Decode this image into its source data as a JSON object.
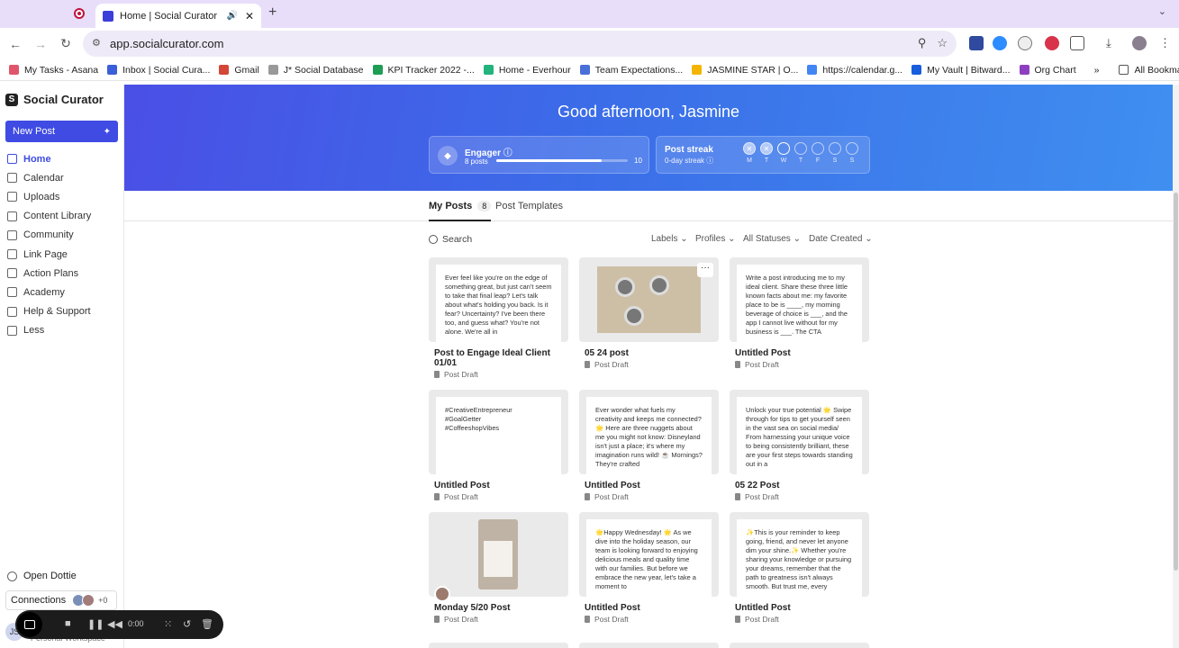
{
  "browser": {
    "tab_title": "Home | Social Curator",
    "tab_close": "✕",
    "new_tab": "+",
    "tab_menu": "⌄",
    "url": "app.socialcurator.com",
    "bookmarks": [
      {
        "label": "My Tasks - Asana",
        "color": "#e0556b"
      },
      {
        "label": "Inbox | Social Cura...",
        "color": "#3b5fd8"
      },
      {
        "label": "Gmail",
        "color": "#d44638"
      },
      {
        "label": "J* Social Database",
        "color": "#999999"
      },
      {
        "label": "KPI Tracker 2022 -...",
        "color": "#1f9d55"
      },
      {
        "label": "Home - Everhour",
        "color": "#23b37d"
      },
      {
        "label": "Team Expectations...",
        "color": "#4a6fd8"
      },
      {
        "label": "JASMINE STAR | O...",
        "color": "#f4b400"
      },
      {
        "label": "https://calendar.g...",
        "color": "#4285f4"
      },
      {
        "label": "My Vault | Bitward...",
        "color": "#175ddc"
      },
      {
        "label": "Org Chart",
        "color": "#8e3fbf"
      }
    ],
    "bookmarks_more": "»",
    "all_bookmarks": "All Bookmarks"
  },
  "sidebar": {
    "brand": "Social Curator",
    "new_post": "New Post",
    "items": [
      {
        "label": "Home",
        "active": true
      },
      {
        "label": "Calendar"
      },
      {
        "label": "Uploads"
      },
      {
        "label": "Content Library"
      },
      {
        "label": "Community"
      },
      {
        "label": "Link Page"
      },
      {
        "label": "Action Plans"
      },
      {
        "label": "Academy"
      },
      {
        "label": "Help & Support"
      },
      {
        "label": "Less"
      }
    ],
    "open_dottie": "Open Dottie",
    "connections": "Connections",
    "connections_more": "+0",
    "workspace_initials": "JS",
    "workspace_label": "Personal Workspace"
  },
  "hero": {
    "greeting": "Good afternoon, Jasmine",
    "engager": {
      "title": "Engager",
      "sub": "8 posts",
      "max": "10",
      "progress": 0.8
    },
    "streak": {
      "title": "Post streak",
      "sub": "0-day streak",
      "days": [
        {
          "label": "M",
          "mark": "✕",
          "state": "done"
        },
        {
          "label": "T",
          "mark": "✕",
          "state": "done"
        },
        {
          "label": "W",
          "mark": "",
          "state": "today"
        },
        {
          "label": "T",
          "mark": "",
          "state": ""
        },
        {
          "label": "F",
          "mark": "",
          "state": ""
        },
        {
          "label": "S",
          "mark": "",
          "state": ""
        },
        {
          "label": "S",
          "mark": "",
          "state": ""
        }
      ]
    }
  },
  "tabs": {
    "my_posts": "My Posts",
    "my_posts_count": "8",
    "templates": "Post Templates"
  },
  "filters": {
    "search": "Search",
    "labels": "Labels ⌄",
    "profiles": "Profiles ⌄",
    "statuses": "All Statuses ⌄",
    "date": "Date Created ⌄"
  },
  "posts": [
    {
      "title": "Post to Engage Ideal Client 01/01",
      "status": "Post Draft",
      "text": "Ever feel like you're on the edge of something great, but just can't seem to take that final leap? Let's talk about what's holding you back. Is it fear? Uncertainty? I've been there too, and guess what? You're not alone. We're all in"
    },
    {
      "title": "05 24 post",
      "status": "Post Draft",
      "text": "",
      "more": "···"
    },
    {
      "title": "Untitled Post",
      "status": "Post Draft",
      "text": "Write a post introducing me to my ideal client. Share these three little known facts about me: my favorite place to be is ____, my morning beverage of choice is ___, and the app I cannot live without for my business is ___. The CTA"
    },
    {
      "title": "Untitled Post",
      "status": "Post Draft",
      "text": "#CreativeEntrepreneur\n#GoalGetter\n#CoffeeshopVibes"
    },
    {
      "title": "Untitled Post",
      "status": "Post Draft",
      "text": "Ever wonder what fuels my creativity and keeps me connected? 🌟 Here are three nuggets about me you might not know: Disneyland isn't just a place; it's where my imagination runs wild! ☕ Mornings? They're crafted"
    },
    {
      "title": "05 22 Post",
      "status": "Post Draft",
      "text": "Unlock your true potential 🌟 Swipe through for tips to get yourself seen in the vast sea on social media/ From harnessing your unique voice to being consistently brilliant, these are your first steps towards standing out in a"
    },
    {
      "title": "Monday 5/20 Post",
      "status": "Post Draft",
      "text": ""
    },
    {
      "title": "Untitled Post",
      "status": "Post Draft",
      "text": "🌟Happy Wednesday! 🌟 As we dive into the holiday season, our team is looking forward to enjoying delicious meals and quality time with our families. But before we embrace the new year, let's take a moment to"
    },
    {
      "title": "Untitled Post",
      "status": "Post Draft",
      "text": "✨This is your reminder to keep going, friend, and never let anyone dim your shine.✨ Whether you're sharing your knowledge or pursuing your dreams, remember that the path to greatness isn't always smooth. But trust me, every"
    }
  ],
  "recorder": {
    "time": "0:00"
  }
}
